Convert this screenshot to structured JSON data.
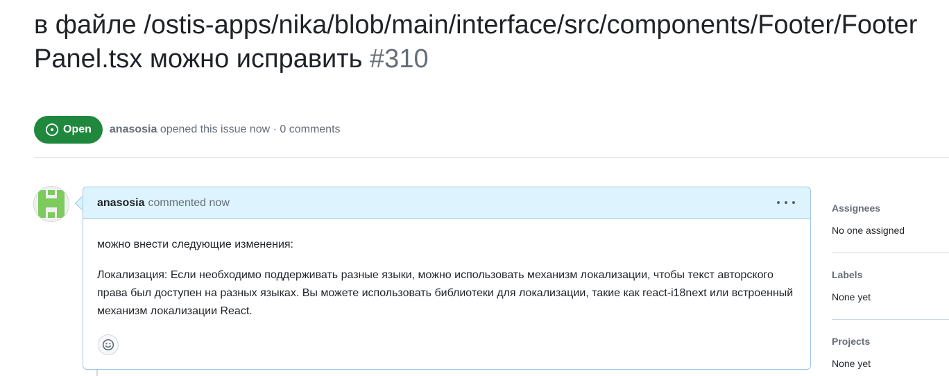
{
  "issue": {
    "title": "в файле /ostis-apps/nika/blob/main/interface/src/components/Footer/FooterPanel.tsx можно исправить",
    "number": "#310",
    "state": "Open",
    "author": "anasosia",
    "opened_text": "opened this issue now · 0 comments"
  },
  "comment": {
    "author": "anasosia",
    "action": "commented now",
    "paragraphs": [
      "можно внести следующие изменения:",
      "Локализация: Если необходимо поддерживать разные языки, можно использовать механизм локализации, чтобы текст авторского права был доступен на разных языках. Вы можете использовать библиотеки для локализации, такие как react-i18next или встроенный механизм локализации React."
    ]
  },
  "sidebar": {
    "sections": [
      {
        "title": "Assignees",
        "value": "No one assigned"
      },
      {
        "title": "Labels",
        "value": "None yet"
      },
      {
        "title": "Projects",
        "value": "None yet"
      }
    ]
  },
  "icons": {
    "state": "issue-opened-icon",
    "avatar": "identicon-avatar",
    "menu": "kebab-horizontal-icon",
    "reaction": "smiley-icon"
  },
  "colors": {
    "open_green": "#1f883d",
    "comment_header_bg": "#ddf4ff",
    "comment_border": "#9fc4e4",
    "avatar_green": "#7ccb5c"
  }
}
